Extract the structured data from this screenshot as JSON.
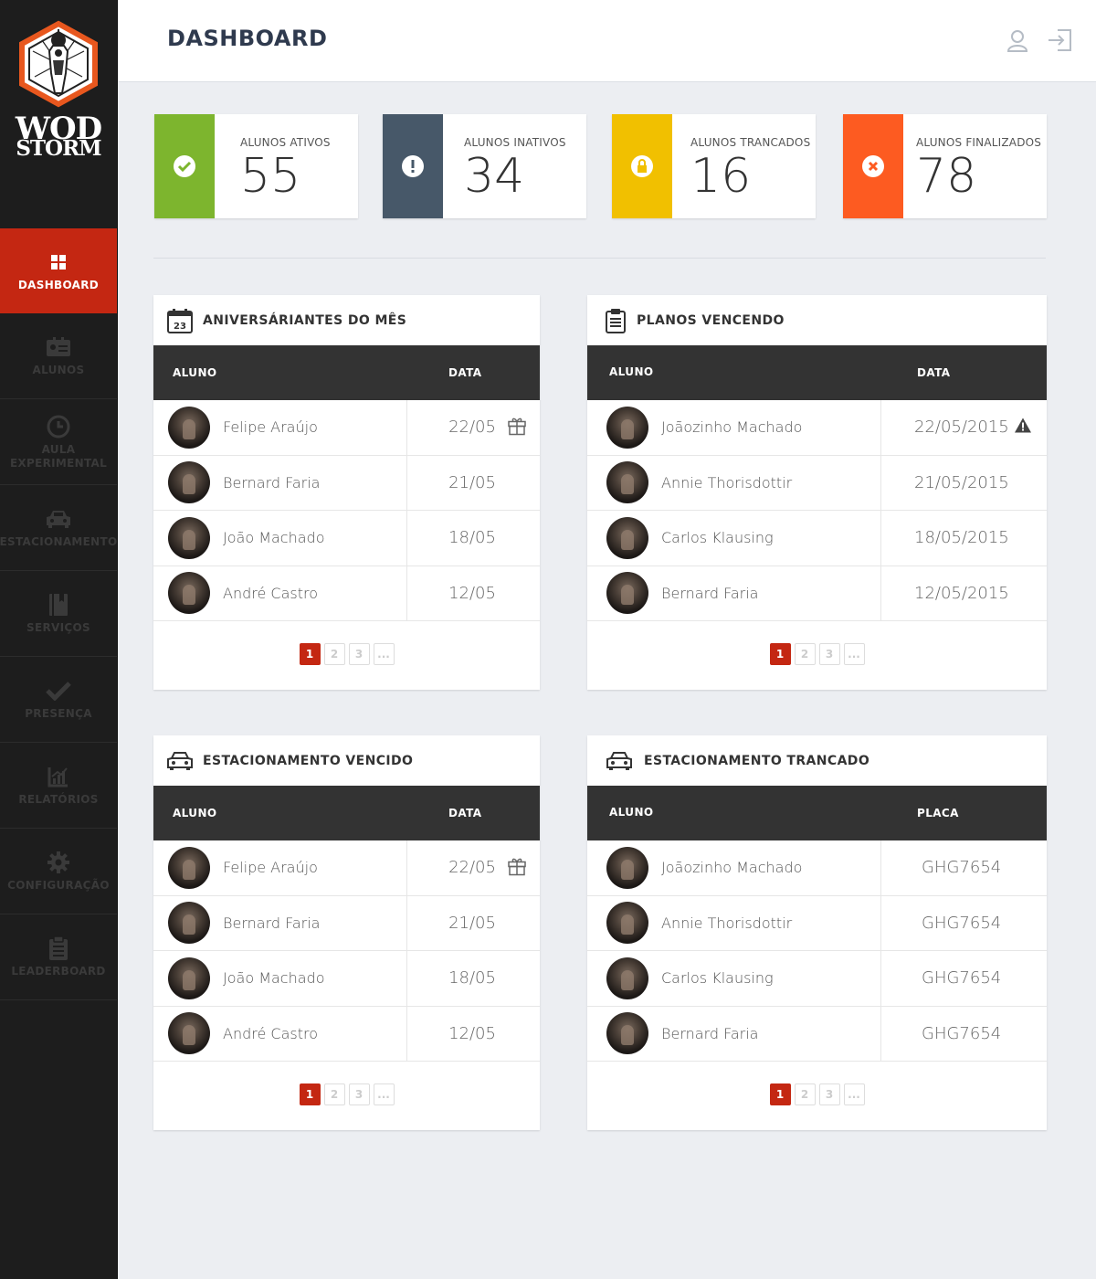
{
  "brand": {
    "line1": "WOD",
    "line2": "STORM"
  },
  "sidebar": {
    "items": [
      {
        "label": "DASHBOARD",
        "icon": "grid-icon"
      },
      {
        "label": "ALUNOS",
        "icon": "id-card-icon"
      },
      {
        "label": "AULA EXPERIMENTAL",
        "icon": "clock-icon"
      },
      {
        "label": "ESTACIONAMENTO",
        "icon": "car-icon"
      },
      {
        "label": "SERVIÇOS",
        "icon": "book-icon"
      },
      {
        "label": "PRESENÇA",
        "icon": "check-icon"
      },
      {
        "label": "RELATÓRIOS",
        "icon": "chart-icon"
      },
      {
        "label": "CONFIGURAÇÃO",
        "icon": "gear-icon"
      },
      {
        "label": "LEADERBOARD",
        "icon": "clipboard-icon"
      }
    ]
  },
  "header": {
    "title": "DASHBOARD"
  },
  "stats": [
    {
      "label": "ALUNOS ATIVOS",
      "value": "55",
      "color": "#7db52e",
      "icon": "check-circle-icon"
    },
    {
      "label": "ALUNOS INATIVOS",
      "value": "34",
      "color": "#475869",
      "icon": "exclamation-circle-icon"
    },
    {
      "label": "ALUNOS TRANCADOS",
      "value": "16",
      "color": "#f1c000",
      "icon": "lock-circle-icon"
    },
    {
      "label": "ALUNOS FINALIZADOS",
      "value": "78",
      "color": "#fd5b21",
      "icon": "x-circle-icon"
    }
  ],
  "panels": {
    "birthdays": {
      "title": "ANIVERSÁRIANTES DO MÊS",
      "col1": "ALUNO",
      "col2": "DATA",
      "rows": [
        {
          "name": "Felipe Araújo",
          "value": "22/05"
        },
        {
          "name": "Bernard Faria",
          "value": "21/05"
        },
        {
          "name": "João Machado",
          "value": "18/05"
        },
        {
          "name": "André Castro",
          "value": "12/05"
        }
      ],
      "calendar_day": "23"
    },
    "plans": {
      "title": "PLANOS VENCENDO",
      "col1": "ALUNO",
      "col2": "DATA",
      "rows": [
        {
          "name": "Joãozinho Machado",
          "value": "22/05/2015"
        },
        {
          "name": "Annie Thorisdottir",
          "value": "21/05/2015"
        },
        {
          "name": "Carlos Klausing",
          "value": "18/05/2015"
        },
        {
          "name": "Bernard Faria",
          "value": "12/05/2015"
        }
      ]
    },
    "parking_expired": {
      "title": "ESTACIONAMENTO VENCIDO",
      "col1": "ALUNO",
      "col2": "DATA",
      "rows": [
        {
          "name": "Felipe Araújo",
          "value": "22/05"
        },
        {
          "name": "Bernard Faria",
          "value": "21/05"
        },
        {
          "name": "João Machado",
          "value": "18/05"
        },
        {
          "name": "André Castro",
          "value": "12/05"
        }
      ]
    },
    "parking_locked": {
      "title": "ESTACIONAMENTO TRANCADO",
      "col1": "ALUNO",
      "col2": "PLACA",
      "rows": [
        {
          "name": "Joãozinho Machado",
          "value": "GHG7654"
        },
        {
          "name": "Annie Thorisdottir",
          "value": "GHG7654"
        },
        {
          "name": "Carlos Klausing",
          "value": "GHG7654"
        },
        {
          "name": "Bernard Faria",
          "value": "GHG7654"
        }
      ]
    }
  },
  "pagination": [
    "1",
    "2",
    "3",
    "..."
  ],
  "colors": {
    "sidebar_bg": "#1d1d1d",
    "active_red": "#c42712",
    "table_header": "#333333"
  }
}
